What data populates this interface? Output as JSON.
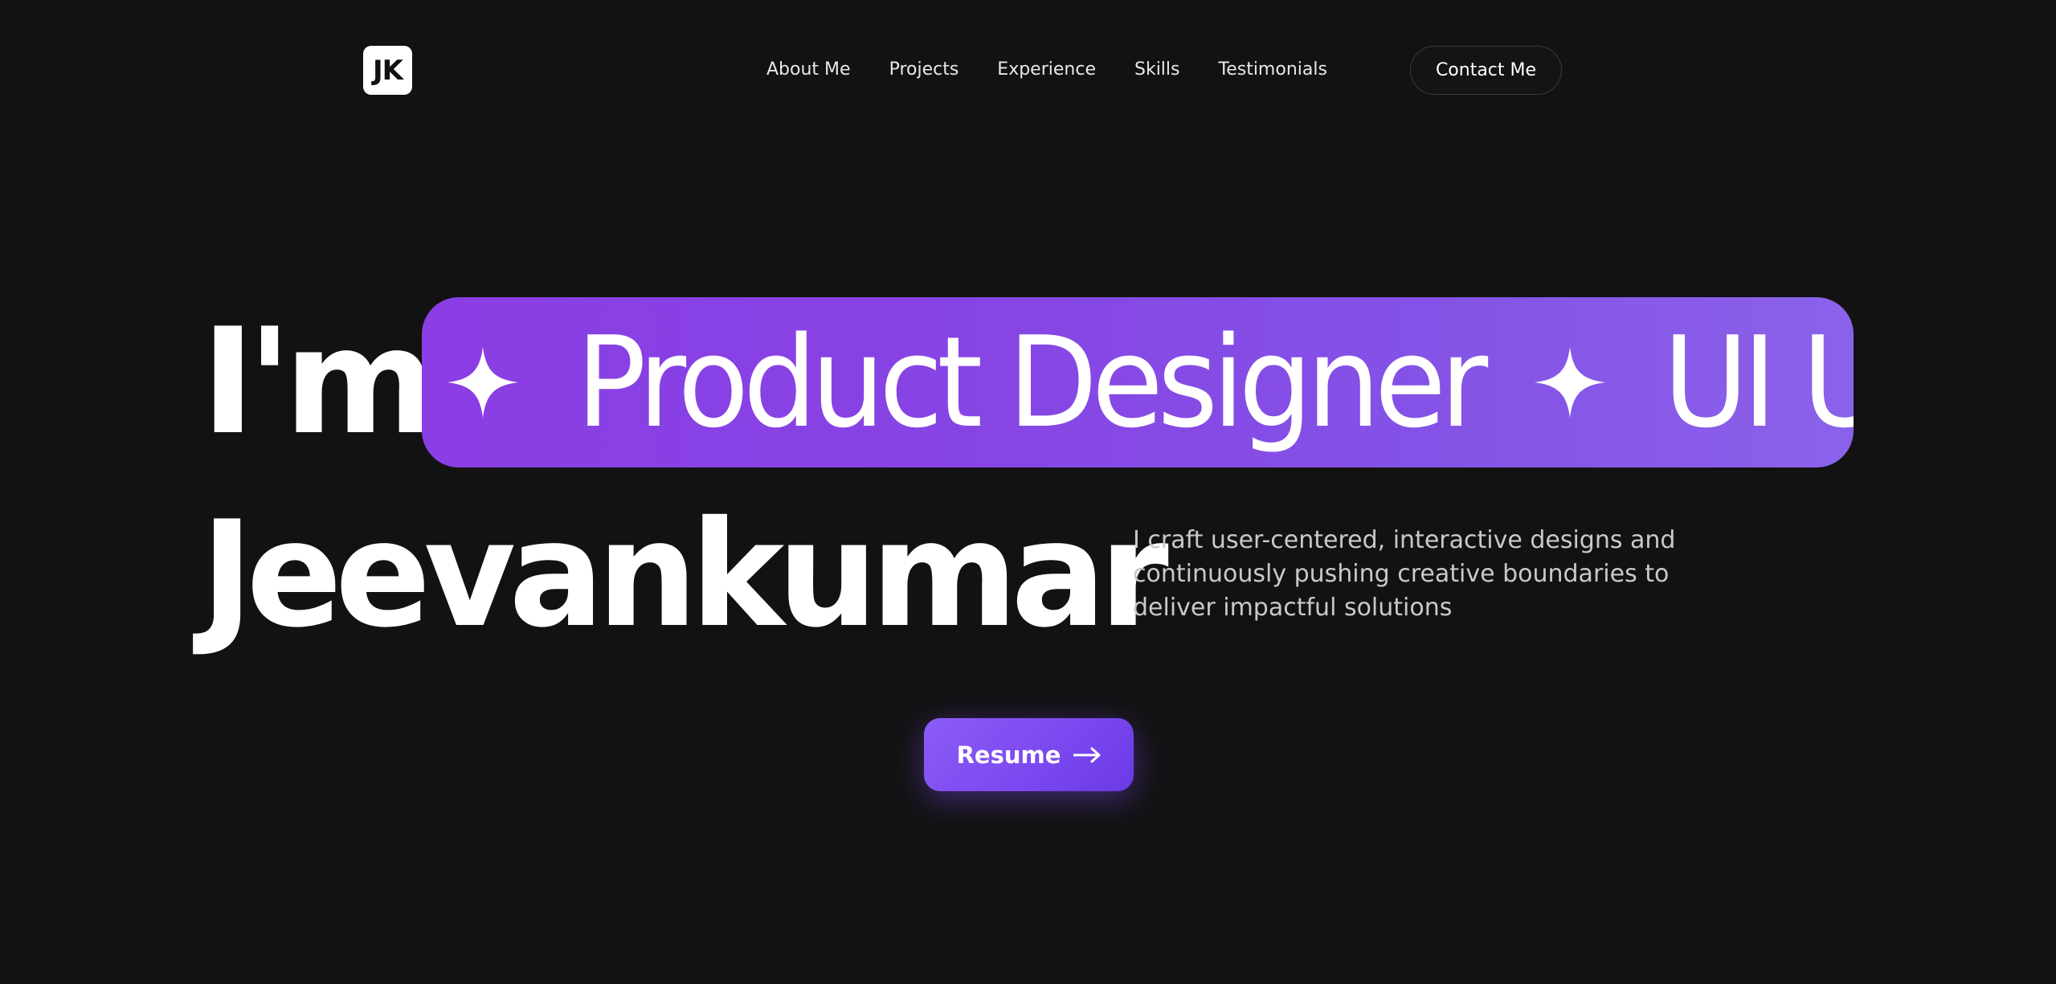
{
  "header": {
    "logo_text": "JK",
    "nav": [
      {
        "label": "About Me"
      },
      {
        "label": "Projects"
      },
      {
        "label": "Experience"
      },
      {
        "label": "Skills"
      },
      {
        "label": "Testimonials"
      }
    ],
    "contact_label": "Contact Me"
  },
  "hero": {
    "prefix": "I'm",
    "roles": [
      "Product Designer",
      "UI UX"
    ],
    "name": "Jeevankumar",
    "description": "I craft user-centered, interactive designs and continuously pushing creative boundaries to deliver impactful solutions",
    "resume_label": "Resume"
  },
  "colors": {
    "background": "#121212",
    "accent_start": "#8a3ee3",
    "accent_end": "#8a62ea",
    "button": "#7c49f0",
    "text_primary": "#ffffff",
    "text_muted": "#c9c9c9"
  },
  "icons": {
    "logo": "jk-monogram-logo",
    "separator": "four-point-sparkle-icon",
    "resume": "arrow-right-icon"
  }
}
